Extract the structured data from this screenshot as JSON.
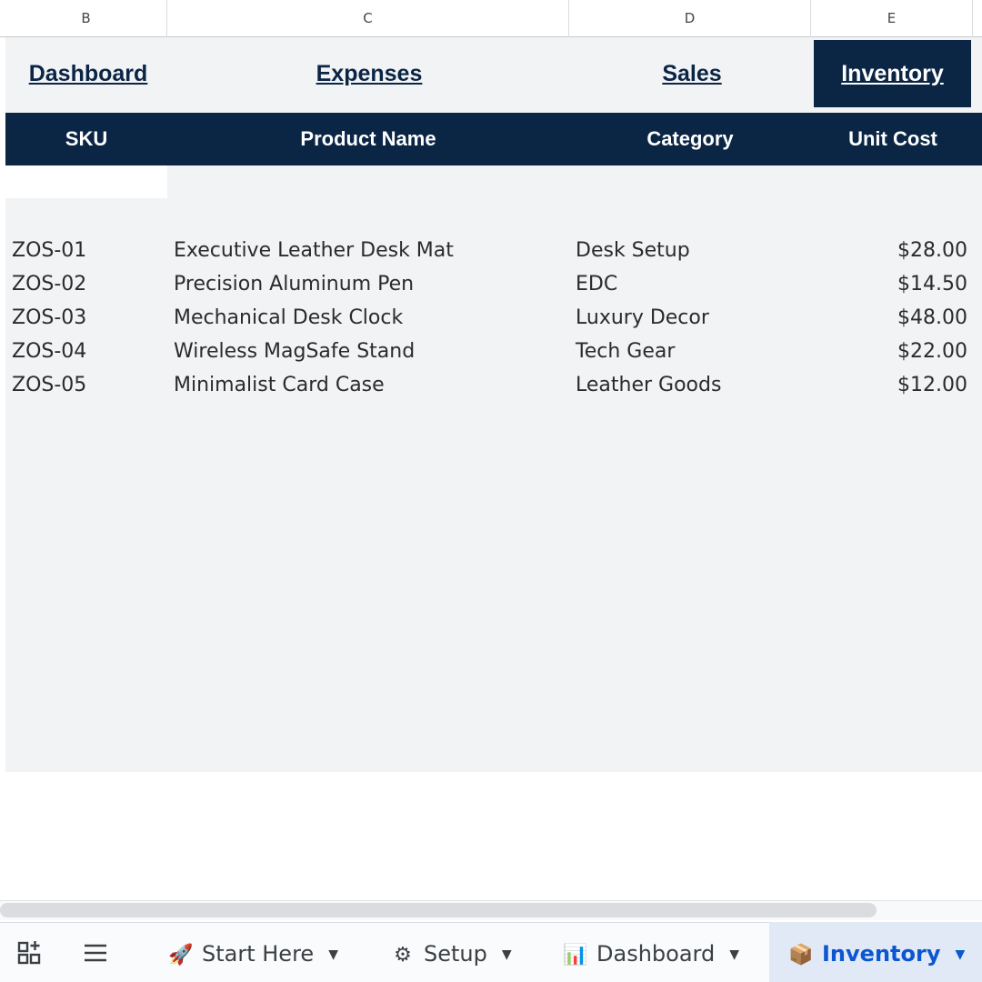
{
  "columns": [
    "B",
    "C",
    "D",
    "E"
  ],
  "nav": {
    "dashboard": "Dashboard",
    "expenses": "Expenses",
    "sales": "Sales",
    "inventory": "Inventory"
  },
  "table": {
    "headers": {
      "sku": "SKU",
      "name": "Product Name",
      "category": "Category",
      "cost": "Unit Cost"
    },
    "rows": [
      {
        "sku": "ZOS-01",
        "name": "Executive Leather Desk Mat",
        "category": "Desk Setup",
        "cost": "$28.00"
      },
      {
        "sku": "ZOS-02",
        "name": "Precision Aluminum Pen",
        "category": "EDC",
        "cost": "$14.50"
      },
      {
        "sku": "ZOS-03",
        "name": "Mechanical Desk Clock",
        "category": "Luxury Decor",
        "cost": "$48.00"
      },
      {
        "sku": "ZOS-04",
        "name": "Wireless MagSafe Stand",
        "category": "Tech Gear",
        "cost": "$22.00"
      },
      {
        "sku": "ZOS-05",
        "name": "Minimalist Card Case",
        "category": "Leather Goods",
        "cost": "$12.00"
      }
    ]
  },
  "sheet_tabs": [
    {
      "label": "Start Here",
      "icon": "rocket-icon",
      "emoji": "🚀"
    },
    {
      "label": "Setup",
      "icon": "gear-icon",
      "emoji": "⚙"
    },
    {
      "label": "Dashboard",
      "icon": "bar-chart-icon",
      "emoji": "📊"
    },
    {
      "label": "Inventory",
      "icon": "package-icon",
      "emoji": "📦"
    }
  ],
  "active_tab": "Inventory",
  "colors": {
    "navy": "#0b2545",
    "sheet_bg": "#f1f3f4",
    "active_tab_text": "#0b57d0"
  }
}
